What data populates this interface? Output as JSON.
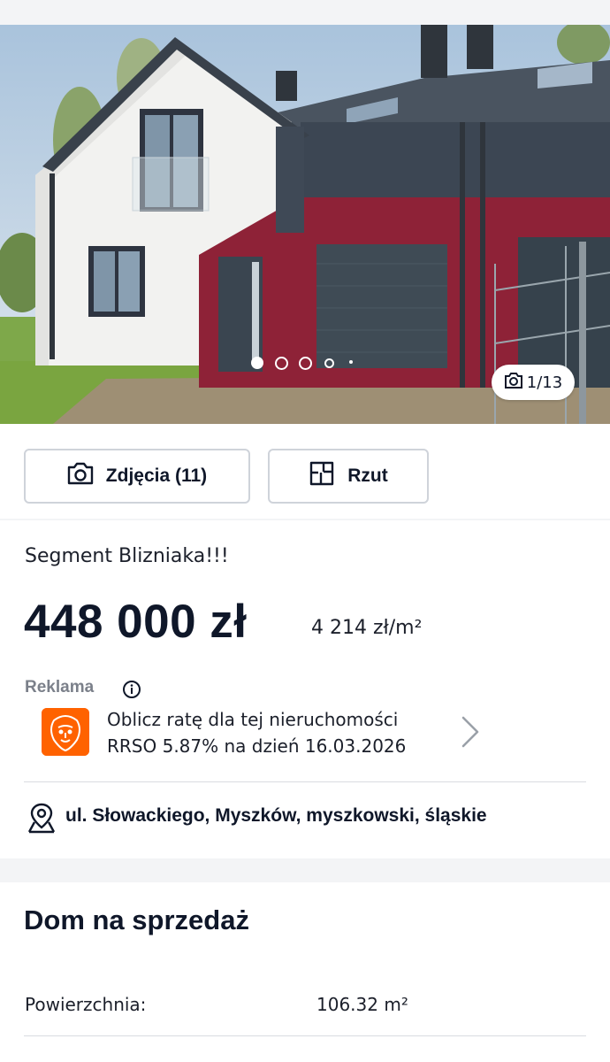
{
  "gallery": {
    "counter": "1/13",
    "active_dot": 0
  },
  "buttons": {
    "photos_label": "Zdjęcia (11)",
    "plan_label": "Rzut"
  },
  "listing": {
    "title": "Segment Blizniaka!!!",
    "price": "448 000 zł",
    "price_per_m2": "4 214 zł/m²"
  },
  "ad": {
    "label": "Reklama",
    "line1": "Oblicz ratę dla tej nieruchomości",
    "line2": "RRSO 5.87% na dzień 16.03.2026",
    "brand_color": "#ff6200"
  },
  "location": {
    "address": "ul. Słowackiego, Myszków, myszkowski, śląskie"
  },
  "details": {
    "section_title": "Dom na sprzedaż",
    "rows": [
      {
        "label": "Powierzchnia:",
        "value": "106.32 m²"
      }
    ]
  },
  "icons": [
    "camera-icon",
    "floor-plan-icon",
    "info-icon",
    "location-pin-icon",
    "chevron-right-icon"
  ]
}
